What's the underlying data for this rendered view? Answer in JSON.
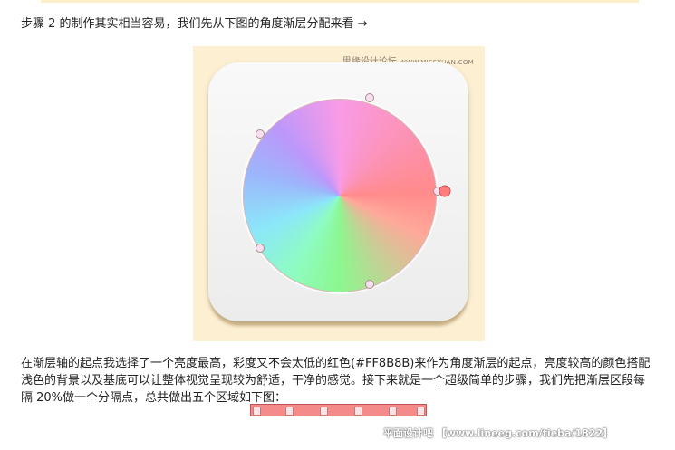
{
  "intro_text": "步骤 2 的制作其实相当容易，我们先从下图的角度渐层分配来看 →",
  "figure": {
    "watermark_cn": "思缘设计论坛",
    "watermark_url": "WWW.MISSYUAN.COM",
    "colors": {
      "start_red": "#FF8B8B",
      "background": "#FCEFD2"
    }
  },
  "body_text": "在渐层轴的起点我选择了一个亮度最高，彩度又不会太低的红色(#FF8B8B)来作为角度渐层的起点，亮度较高的颜色搭配浅色的背景以及基底可以让整体视觉呈现较为舒适，干净的感觉。接下来就是一个超级简单的步骤，我们先把渐层区段每隔 20%做一个分隔点，总共做出五个区域如下图：",
  "credit_text": "平面设计吧 【www.lineeg.com/tieba/1822】"
}
